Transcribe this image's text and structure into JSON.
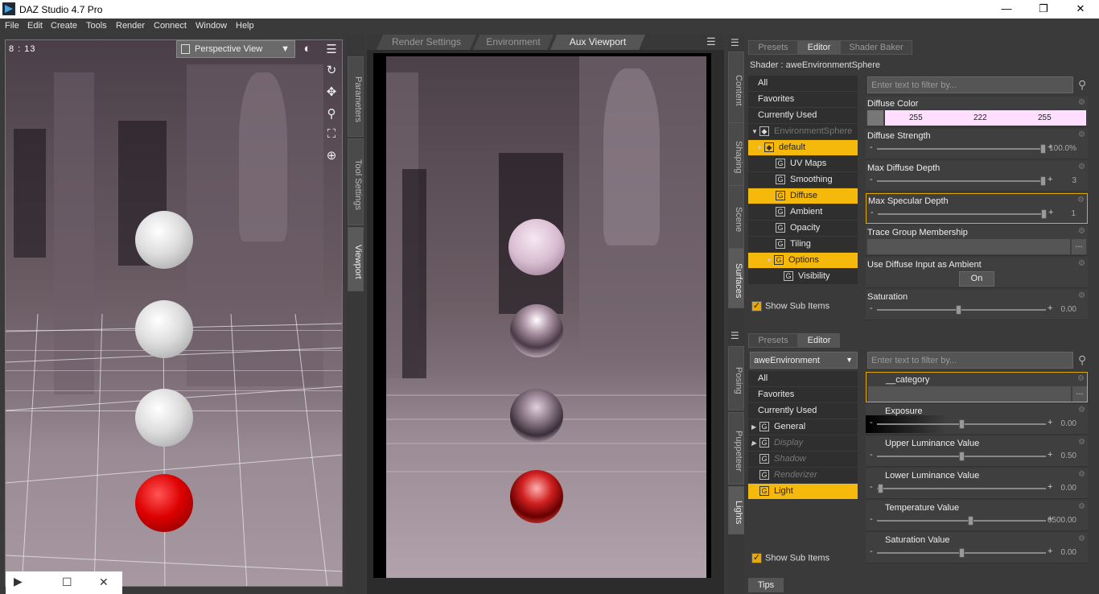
{
  "window": {
    "title": "DAZ Studio 4.7 Pro",
    "minimize": "—",
    "restore": "❐",
    "close": "✕"
  },
  "menu": [
    "File",
    "Edit",
    "Create",
    "Tools",
    "Render",
    "Connect",
    "Window",
    "Help"
  ],
  "viewport": {
    "frame_time": "8 : 13",
    "view_select": "Perspective View"
  },
  "left_tabs": [
    "Parameters",
    "Tool Settings",
    "Viewport"
  ],
  "center_tabs": [
    "Render Settings",
    "Environment",
    "Aux Viewport"
  ],
  "right_tabs_top": [
    "Content",
    "Shaping",
    "Scene",
    "Surfaces"
  ],
  "right_tabs_bottom": [
    "Posing",
    "Puppeteer",
    "Lights"
  ],
  "surfaces_panel": {
    "tabs": [
      "Presets",
      "Editor",
      "Shader Baker"
    ],
    "shader_label": "Shader : aweEnvironmentSphere",
    "filter_placeholder": "Enter text to filter by...",
    "list": [
      {
        "label": "All",
        "style": "flat"
      },
      {
        "label": "Favorites",
        "style": "flat"
      },
      {
        "label": "Currently Used",
        "style": "flat"
      },
      {
        "label": "EnvironmentSphere",
        "style": "node"
      },
      {
        "label": "default",
        "style": "group-sel"
      },
      {
        "label": "UV Maps",
        "style": "g"
      },
      {
        "label": "Smoothing",
        "style": "g"
      },
      {
        "label": "Diffuse",
        "style": "g-sel"
      },
      {
        "label": "Ambient",
        "style": "g"
      },
      {
        "label": "Opacity",
        "style": "g"
      },
      {
        "label": "Tiling",
        "style": "g"
      },
      {
        "label": "Options",
        "style": "g-open-sel"
      },
      {
        "label": "Visibility",
        "style": "g-sub"
      }
    ],
    "show_sub_items": "Show Sub Items",
    "properties": [
      {
        "name": "Diffuse Color",
        "r": "255",
        "g": "222",
        "b": "255"
      },
      {
        "name": "Diffuse Strength",
        "value": "100.0%",
        "pos": 0.98
      },
      {
        "name": "Max Diffuse Depth",
        "value": "3",
        "pos": 0.98
      },
      {
        "name": "Max Specular Depth",
        "value": "1",
        "pos": 0.98
      },
      {
        "name": "Trace Group Membership"
      },
      {
        "name": "Use Diffuse Input as Ambient",
        "toggle": "On"
      },
      {
        "name": "Saturation",
        "value": "0.00",
        "pos": 0.48
      }
    ]
  },
  "lights_panel": {
    "tabs": [
      "Presets",
      "Editor"
    ],
    "node_select": "aweEnvironment",
    "filter_placeholder": "Enter text to filter by...",
    "list": [
      {
        "label": "All",
        "style": "flat"
      },
      {
        "label": "Favorites",
        "style": "flat"
      },
      {
        "label": "Currently Used",
        "style": "flat"
      },
      {
        "label": "General",
        "style": "g-closed"
      },
      {
        "label": "Display",
        "style": "g-closed-dim"
      },
      {
        "label": "Shadow",
        "style": "g-dim"
      },
      {
        "label": "Renderizer",
        "style": "g-dim"
      },
      {
        "label": "Light",
        "style": "g-sel"
      }
    ],
    "show_sub_items": "Show Sub Items",
    "properties": [
      {
        "name": "__category"
      },
      {
        "name": "Exposure",
        "value": "0.00",
        "pos": 0.5
      },
      {
        "name": "Upper Luminance Value",
        "value": "0.50",
        "pos": 0.5
      },
      {
        "name": "Lower Luminance Value",
        "value": "0.00",
        "pos": 0.02
      },
      {
        "name": "Temperature Value",
        "value": "6500.00",
        "pos": 0.55
      },
      {
        "name": "Saturation Value",
        "value": "0.00",
        "pos": 0.5
      }
    ]
  },
  "tips_tab": "Tips",
  "colors": {
    "accent": "#f4b90a",
    "panel": "#3a3a3a",
    "diffuse_swatch": "#ffdeff"
  }
}
